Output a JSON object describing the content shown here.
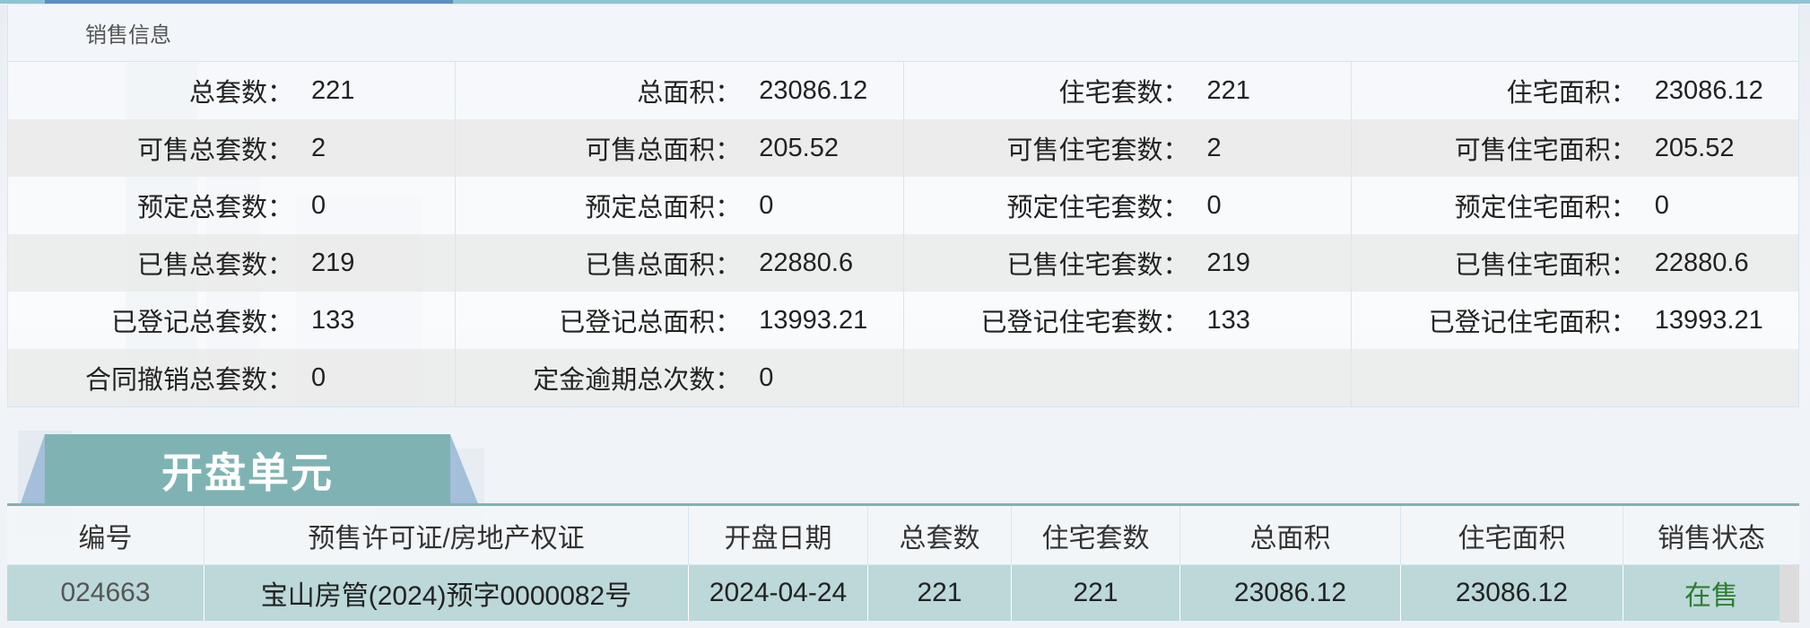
{
  "sales_info": {
    "header": "销售信息",
    "rows": [
      [
        {
          "label": "总套数：",
          "value": "221"
        },
        {
          "label": "总面积：",
          "value": "23086.12"
        },
        {
          "label": "住宅套数：",
          "value": "221"
        },
        {
          "label": "住宅面积：",
          "value": "23086.12"
        }
      ],
      [
        {
          "label": "可售总套数：",
          "value": "2"
        },
        {
          "label": "可售总面积：",
          "value": "205.52"
        },
        {
          "label": "可售住宅套数：",
          "value": "2"
        },
        {
          "label": "可售住宅面积：",
          "value": "205.52"
        }
      ],
      [
        {
          "label": "预定总套数：",
          "value": "0"
        },
        {
          "label": "预定总面积：",
          "value": "0"
        },
        {
          "label": "预定住宅套数：",
          "value": "0"
        },
        {
          "label": "预定住宅面积：",
          "value": "0"
        }
      ],
      [
        {
          "label": "已售总套数：",
          "value": "219"
        },
        {
          "label": "已售总面积：",
          "value": "22880.6"
        },
        {
          "label": "已售住宅套数：",
          "value": "219"
        },
        {
          "label": "已售住宅面积：",
          "value": "22880.6"
        }
      ],
      [
        {
          "label": "已登记总套数：",
          "value": "133"
        },
        {
          "label": "已登记总面积：",
          "value": "13993.21"
        },
        {
          "label": "已登记住宅套数：",
          "value": "133"
        },
        {
          "label": "已登记住宅面积：",
          "value": "13993.21"
        }
      ],
      [
        {
          "label": "合同撤销总套数：",
          "value": "0"
        },
        {
          "label": "定金逾期总次数：",
          "value": "0"
        },
        {
          "label": "",
          "value": ""
        },
        {
          "label": "",
          "value": ""
        }
      ]
    ]
  },
  "units_section": {
    "tab_label": "开盘单元",
    "columns": [
      "编号",
      "预售许可证/房地产权证",
      "开盘日期",
      "总套数",
      "住宅套数",
      "总面积",
      "住宅面积",
      "销售状态"
    ],
    "rows": [
      [
        "024663",
        "宝山房管(2024)预字0000082号",
        "2024-04-24",
        "221",
        "221",
        "23086.12",
        "23086.12",
        "在售"
      ]
    ]
  },
  "colors": {
    "tab_bg": "#7fb3b3",
    "row_bg": "#bcd8d9",
    "status_on_sale": "#2e7d32",
    "border": "#d6e6ef"
  }
}
